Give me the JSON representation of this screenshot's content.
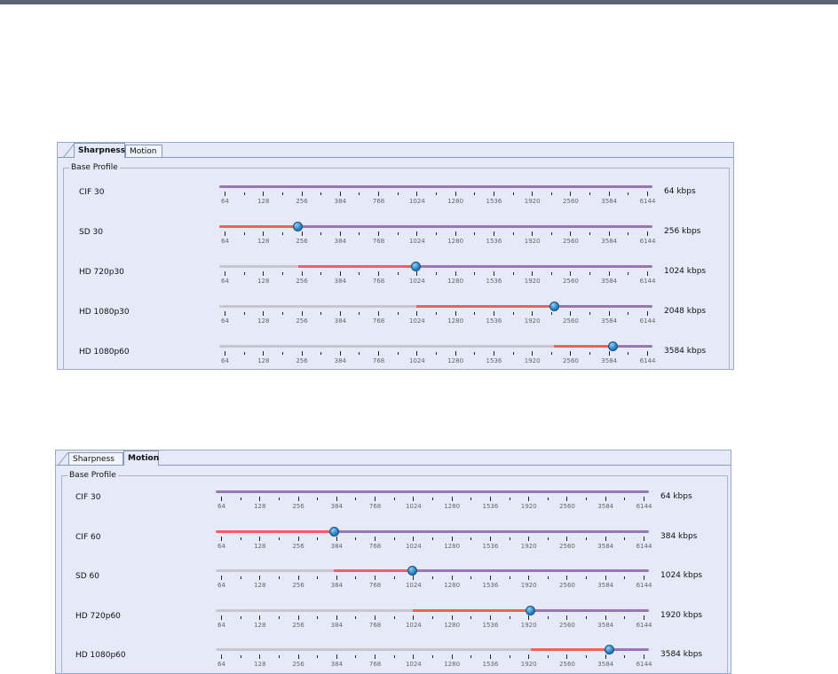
{
  "ticks": [
    "64",
    "128",
    "256",
    "384",
    "768",
    "1024",
    "1280",
    "1536",
    "1920",
    "2560",
    "3584",
    "6144"
  ],
  "colors": {
    "fill": "#f55e5e",
    "range": "#9977b2",
    "inactive": "#c9c7cd",
    "thumb": "#2a86c7"
  },
  "panels": [
    {
      "tabs": [
        {
          "label": "Sharpness",
          "active": true
        },
        {
          "label": "Motion",
          "active": false
        }
      ],
      "group_label": "Base Profile",
      "rows": [
        {
          "label": "CIF 30",
          "value": "64 kbps",
          "min_index": 0,
          "sel_index": 0
        },
        {
          "label": "SD 30",
          "value": "256 kbps",
          "min_index": 0,
          "sel_index": 2
        },
        {
          "label": "HD 720p30",
          "value": "1024 kbps",
          "min_index": 2,
          "sel_index": 5
        },
        {
          "label": "HD 1080p30",
          "value": "2048 kbps",
          "min_index": 5,
          "sel_index": 8.5
        },
        {
          "label": "HD 1080p60",
          "value": "3584 kbps",
          "min_index": 8.5,
          "sel_index": 10
        }
      ]
    },
    {
      "tabs": [
        {
          "label": "Sharpness",
          "active": false
        },
        {
          "label": "Motion",
          "active": true
        }
      ],
      "group_label": "Base Profile",
      "rows": [
        {
          "label": "CIF 30",
          "value": "64 kbps",
          "min_index": 0,
          "sel_index": 0
        },
        {
          "label": "CIF 60",
          "value": "384 kbps",
          "min_index": 0,
          "sel_index": 3
        },
        {
          "label": "SD 60",
          "value": "1024 kbps",
          "min_index": 3,
          "sel_index": 5
        },
        {
          "label": "HD 720p60",
          "value": "1920 kbps",
          "min_index": 5,
          "sel_index": 8
        },
        {
          "label": "HD 1080p60",
          "value": "3584 kbps",
          "min_index": 8,
          "sel_index": 10
        }
      ]
    }
  ]
}
